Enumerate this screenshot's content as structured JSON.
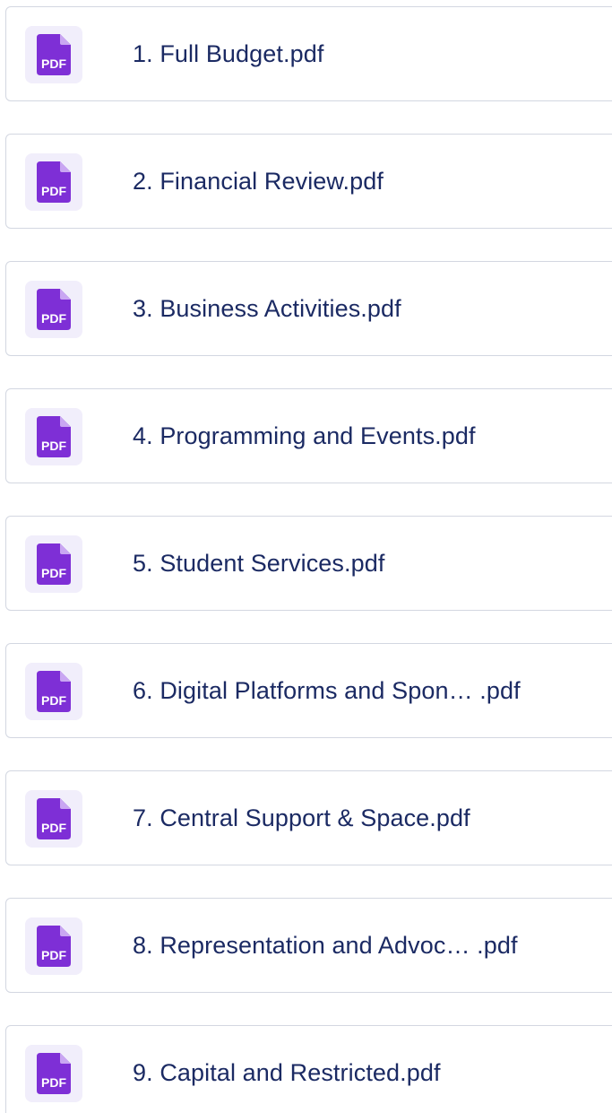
{
  "files": [
    {
      "name": "1. Full Budget.pdf",
      "icon": "pdf-file-icon",
      "icon_text": "PDF"
    },
    {
      "name": "2. Financial Review.pdf",
      "icon": "pdf-file-icon",
      "icon_text": "PDF"
    },
    {
      "name": "3. Business Activities.pdf",
      "icon": "pdf-file-icon",
      "icon_text": "PDF"
    },
    {
      "name": "4. Programming and Events.pdf",
      "icon": "pdf-file-icon",
      "icon_text": "PDF"
    },
    {
      "name": "5. Student Services.pdf",
      "icon": "pdf-file-icon",
      "icon_text": "PDF"
    },
    {
      "name": "6. Digital Platforms and Spon… .pdf",
      "icon": "pdf-file-icon",
      "icon_text": "PDF"
    },
    {
      "name": "7. Central Support & Space.pdf",
      "icon": "pdf-file-icon",
      "icon_text": "PDF"
    },
    {
      "name": "8. Representation and Advoc… .pdf",
      "icon": "pdf-file-icon",
      "icon_text": "PDF"
    },
    {
      "name": "9. Capital and Restricted.pdf",
      "icon": "pdf-file-icon",
      "icon_text": "PDF"
    }
  ],
  "colors": {
    "icon_purple": "#7e2fd6",
    "icon_tile_bg": "#f1eefb",
    "text": "#1b2a63",
    "border": "#d3d7e1"
  }
}
